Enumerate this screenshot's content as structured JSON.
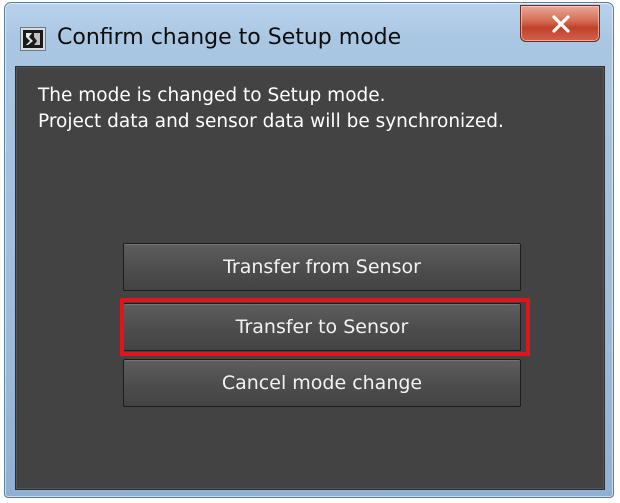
{
  "window": {
    "title": "Confirm change to Setup mode",
    "icons": {
      "app": "app-icon",
      "close": "close-icon"
    }
  },
  "message": {
    "line1": "The mode is changed to Setup mode.",
    "line2": "Project data and sensor data will be synchronized."
  },
  "buttons": {
    "transfer_from_sensor": "Transfer from Sensor",
    "transfer_to_sensor": "Transfer to Sensor",
    "cancel_mode_change": "Cancel mode change"
  },
  "colors": {
    "highlight": "#e3131b",
    "client_background": "#434343",
    "close_button": "#c2412a"
  }
}
